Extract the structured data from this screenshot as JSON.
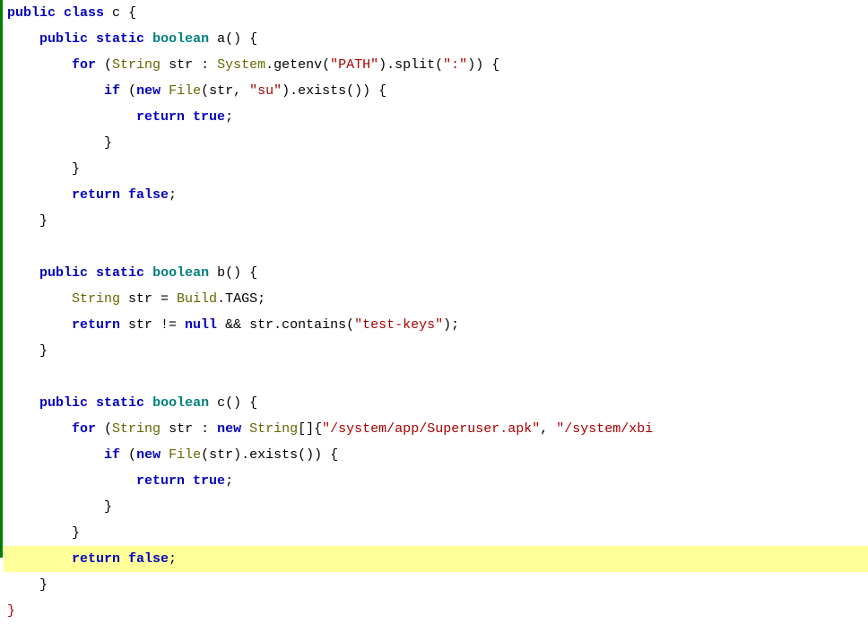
{
  "code": {
    "lines": [
      {
        "ind": 0,
        "spans": [
          {
            "t": "public class",
            "c": "kw"
          },
          {
            "t": " ",
            "c": "id"
          },
          {
            "t": "c",
            "c": "id"
          },
          {
            "t": " {",
            "c": "brace"
          }
        ]
      },
      {
        "ind": 1,
        "spans": [
          {
            "t": "public static",
            "c": "kw"
          },
          {
            "t": " ",
            "c": "id"
          },
          {
            "t": "boolean",
            "c": "type"
          },
          {
            "t": " ",
            "c": "id"
          },
          {
            "t": "a",
            "c": "id"
          },
          {
            "t": "() {",
            "c": "brace"
          }
        ]
      },
      {
        "ind": 2,
        "spans": [
          {
            "t": "for",
            "c": "kw"
          },
          {
            "t": " (",
            "c": "paren"
          },
          {
            "t": "String",
            "c": "cls"
          },
          {
            "t": " str ",
            "c": "id"
          },
          {
            "t": ":",
            "c": "op"
          },
          {
            "t": " ",
            "c": "id"
          },
          {
            "t": "System",
            "c": "cls"
          },
          {
            "t": ".getenv(",
            "c": "id"
          },
          {
            "t": "\"PATH\"",
            "c": "str"
          },
          {
            "t": ").split(",
            "c": "id"
          },
          {
            "t": "\":\"",
            "c": "str"
          },
          {
            "t": ")) {",
            "c": "brace"
          }
        ]
      },
      {
        "ind": 3,
        "spans": [
          {
            "t": "if",
            "c": "kw"
          },
          {
            "t": " (",
            "c": "paren"
          },
          {
            "t": "new",
            "c": "kw"
          },
          {
            "t": " ",
            "c": "id"
          },
          {
            "t": "File",
            "c": "cls"
          },
          {
            "t": "(str, ",
            "c": "id"
          },
          {
            "t": "\"su\"",
            "c": "str"
          },
          {
            "t": ").exists()) {",
            "c": "brace"
          }
        ]
      },
      {
        "ind": 4,
        "spans": [
          {
            "t": "return true",
            "c": "kw"
          },
          {
            "t": ";",
            "c": "id"
          }
        ]
      },
      {
        "ind": 3,
        "spans": [
          {
            "t": "}",
            "c": "brace"
          }
        ]
      },
      {
        "ind": 2,
        "spans": [
          {
            "t": "}",
            "c": "brace"
          }
        ]
      },
      {
        "ind": 2,
        "spans": [
          {
            "t": "return false",
            "c": "kw"
          },
          {
            "t": ";",
            "c": "id"
          }
        ]
      },
      {
        "ind": 1,
        "spans": [
          {
            "t": "}",
            "c": "brace"
          }
        ]
      },
      {
        "ind": 0,
        "spans": []
      },
      {
        "ind": 1,
        "spans": [
          {
            "t": "public static",
            "c": "kw"
          },
          {
            "t": " ",
            "c": "id"
          },
          {
            "t": "boolean",
            "c": "type"
          },
          {
            "t": " ",
            "c": "id"
          },
          {
            "t": "b",
            "c": "id"
          },
          {
            "t": "() {",
            "c": "brace"
          }
        ]
      },
      {
        "ind": 2,
        "spans": [
          {
            "t": "String",
            "c": "cls"
          },
          {
            "t": " str = ",
            "c": "id"
          },
          {
            "t": "Build",
            "c": "cls"
          },
          {
            "t": ".TAGS;",
            "c": "id"
          }
        ]
      },
      {
        "ind": 2,
        "spans": [
          {
            "t": "return",
            "c": "kw"
          },
          {
            "t": " str != ",
            "c": "id"
          },
          {
            "t": "null",
            "c": "kw"
          },
          {
            "t": " ",
            "c": "id"
          },
          {
            "t": "&&",
            "c": "op"
          },
          {
            "t": " str.contains(",
            "c": "id"
          },
          {
            "t": "\"test-keys\"",
            "c": "str"
          },
          {
            "t": ");",
            "c": "id"
          }
        ]
      },
      {
        "ind": 1,
        "spans": [
          {
            "t": "}",
            "c": "brace"
          }
        ]
      },
      {
        "ind": 0,
        "spans": []
      },
      {
        "ind": 1,
        "spans": [
          {
            "t": "public static",
            "c": "kw"
          },
          {
            "t": " ",
            "c": "id"
          },
          {
            "t": "boolean",
            "c": "type"
          },
          {
            "t": " ",
            "c": "id"
          },
          {
            "t": "c",
            "c": "id"
          },
          {
            "t": "() {",
            "c": "brace"
          }
        ]
      },
      {
        "ind": 2,
        "spans": [
          {
            "t": "for",
            "c": "kw"
          },
          {
            "t": " (",
            "c": "paren"
          },
          {
            "t": "String",
            "c": "cls"
          },
          {
            "t": " str ",
            "c": "id"
          },
          {
            "t": ":",
            "c": "op"
          },
          {
            "t": " ",
            "c": "id"
          },
          {
            "t": "new",
            "c": "kw"
          },
          {
            "t": " ",
            "c": "id"
          },
          {
            "t": "String",
            "c": "cls"
          },
          {
            "t": "[]{",
            "c": "id"
          },
          {
            "t": "\"/system/app/Superuser.apk\"",
            "c": "str"
          },
          {
            "t": ", ",
            "c": "id"
          },
          {
            "t": "\"/system/xbi",
            "c": "str"
          }
        ]
      },
      {
        "ind": 3,
        "spans": [
          {
            "t": "if",
            "c": "kw"
          },
          {
            "t": " (",
            "c": "paren"
          },
          {
            "t": "new",
            "c": "kw"
          },
          {
            "t": " ",
            "c": "id"
          },
          {
            "t": "File",
            "c": "cls"
          },
          {
            "t": "(str).exists()) {",
            "c": "brace"
          }
        ]
      },
      {
        "ind": 4,
        "spans": [
          {
            "t": "return true",
            "c": "kw"
          },
          {
            "t": ";",
            "c": "id"
          }
        ]
      },
      {
        "ind": 3,
        "spans": [
          {
            "t": "}",
            "c": "brace"
          }
        ]
      },
      {
        "ind": 2,
        "spans": [
          {
            "t": "}",
            "c": "brace"
          }
        ]
      },
      {
        "ind": 2,
        "highlighted": true,
        "spans": [
          {
            "t": "return false",
            "c": "kw"
          },
          {
            "t": ";",
            "c": "id"
          }
        ]
      },
      {
        "ind": 1,
        "spans": [
          {
            "t": "}",
            "c": "brace"
          }
        ]
      },
      {
        "ind": 0,
        "spans": [
          {
            "t": "}",
            "c": "last-brace"
          }
        ]
      }
    ],
    "indent_unit": "    "
  }
}
